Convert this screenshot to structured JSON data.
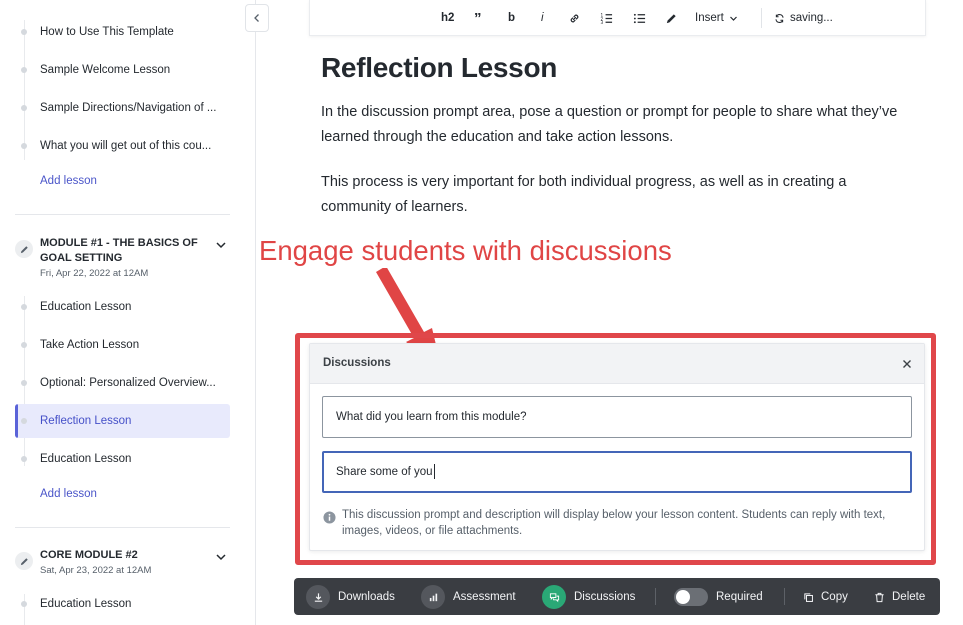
{
  "sidebar": {
    "top_lessons": [
      "How to Use This Template",
      "Sample Welcome Lesson",
      "Sample Directions/Navigation of ...",
      "What you will get out of this cou..."
    ],
    "add_lesson_label": "Add lesson",
    "module1": {
      "title": "MODULE #1 - THE BASICS OF GOAL SETTING",
      "date": "Fri, Apr 22, 2022 at 12AM",
      "lessons": [
        "Education Lesson",
        "Take Action Lesson",
        "Optional: Personalized Overview...",
        "Reflection Lesson",
        "Education Lesson"
      ],
      "active_index": 3
    },
    "module2": {
      "title": "CORE MODULE #2",
      "date": "Sat, Apr 23, 2022 at 12AM",
      "lessons": [
        "Education Lesson"
      ]
    }
  },
  "toolbar": {
    "h2": "h2",
    "quote": "”",
    "bold": "b",
    "italic": "i",
    "insert_label": "Insert",
    "status": "saving..."
  },
  "lesson": {
    "title": "Reflection Lesson",
    "paragraphs": [
      "In the discussion prompt area, pose a question or prompt for people to share what they’ve learned through the education and take action lessons.",
      "This process is very important for both individual progress, as well as in creating a community of learners."
    ]
  },
  "annotation": {
    "text": "Engage students with discussions",
    "color": "#e04545"
  },
  "discussions": {
    "title": "Discussions",
    "prompt_value": "What did you learn from this module?",
    "description_value": "Share some of you",
    "info": "This discussion prompt and description will display below your lesson content. Students can reply with text, images, videos, or file attachments."
  },
  "actionbar": {
    "downloads": "Downloads",
    "assessment": "Assessment",
    "discussions": "Discussions",
    "required": "Required",
    "copy": "Copy",
    "delete": "Delete",
    "required_on": false
  },
  "colors": {
    "accent": "#4a55c9",
    "active_bg": "#e8eafc",
    "frame": "#e0474a",
    "bar_bg": "#3a3d42",
    "discussions_green": "#2aa876"
  }
}
